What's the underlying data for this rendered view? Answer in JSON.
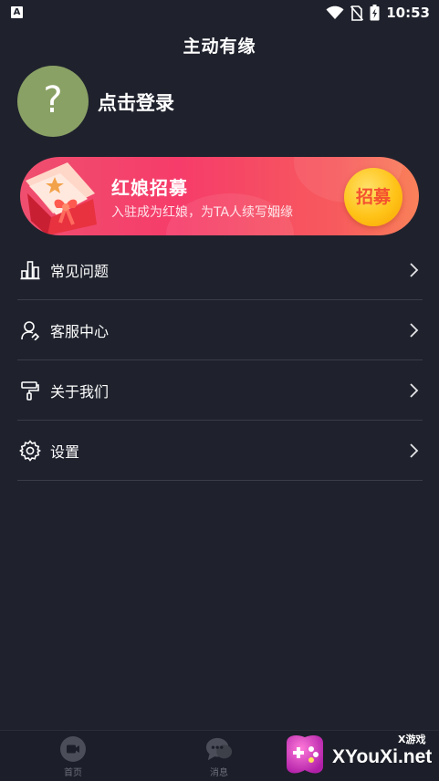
{
  "status_bar": {
    "left_icon": "A",
    "time": "10:53",
    "icons": [
      "wifi-icon",
      "no-sim-icon",
      "battery-icon"
    ]
  },
  "header": {
    "title": "主动有缘"
  },
  "profile": {
    "avatar_glyph": "?",
    "login_label": "点击登录"
  },
  "banner": {
    "title": "红娘招募",
    "subtitle": "入驻成为红娘，为TA人续写姻缘",
    "button_label": "招募"
  },
  "menu": {
    "items": [
      {
        "label": "常见问题",
        "icon": "bar-chart-icon"
      },
      {
        "label": "客服中心",
        "icon": "user-service-icon"
      },
      {
        "label": "关于我们",
        "icon": "paint-roller-icon"
      },
      {
        "label": "设置",
        "icon": "gear-icon"
      }
    ]
  },
  "bottom_nav": {
    "items": [
      {
        "label": "首页",
        "icon": "video-icon"
      },
      {
        "label": "消息",
        "icon": "chat-icon"
      }
    ]
  },
  "watermark": {
    "brand": "XYouXi.net",
    "cn": "X游戏"
  },
  "colors": {
    "background": "#1f222d",
    "avatar": "#8aa165",
    "banner_start": "#ef4f6f",
    "banner_end": "#f9815a",
    "recruit_button": "#ffc318",
    "divider": "#3a3d48"
  }
}
